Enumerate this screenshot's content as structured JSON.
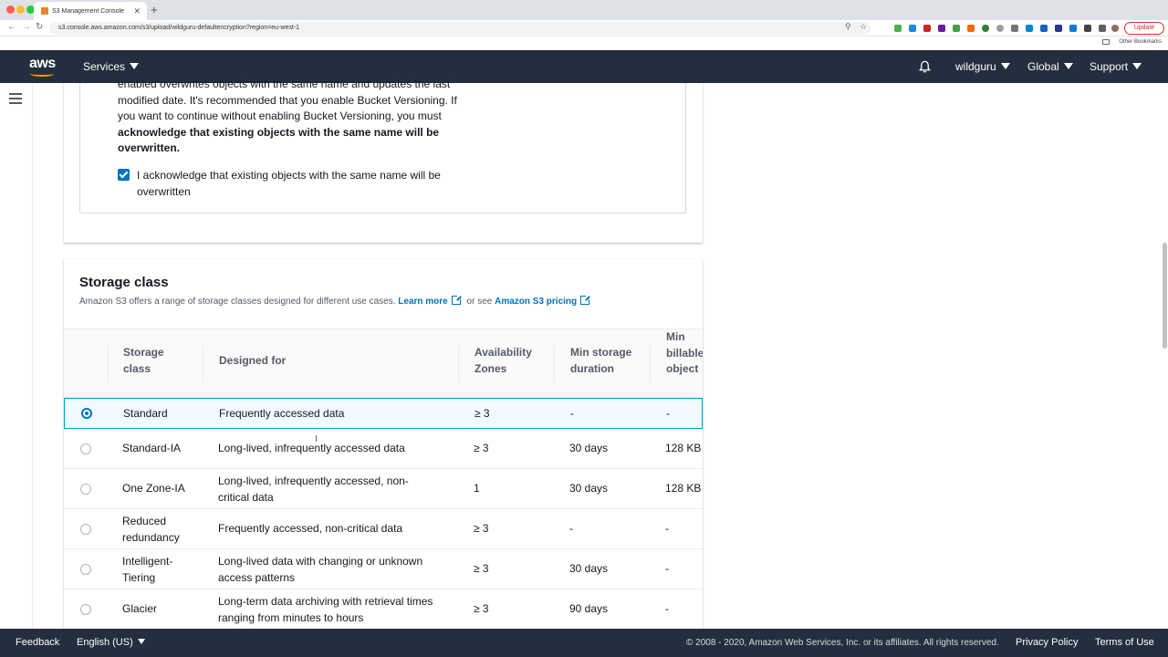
{
  "browser": {
    "tab_title": "S3 Management Console",
    "url": "s3.console.aws.amazon.com/s3/upload/wildguru-defaultencryption?region=eu-west-1",
    "update_label": "Update",
    "other_bookmarks": "Other Bookmarks"
  },
  "header": {
    "logo": "aws",
    "services_label": "Services",
    "account_label": "wildguru",
    "region_label": "Global",
    "support_label": "Support"
  },
  "versioning": {
    "warning_line1": "enabled overwrites objects with the same name and updates the last",
    "warning_line2": "modified date. It's recommended that you enable Bucket Versioning. If",
    "warning_line3": "you want to continue without enabling Bucket Versioning, you must",
    "warning_bold1": "acknowledge that existing objects with the same name will be",
    "warning_bold2": "overwritten.",
    "acknowledge_label": "I acknowledge that existing objects with the same name will be overwritten"
  },
  "storage_class": {
    "title": "Storage class",
    "description": "Amazon S3 offers a range of storage classes designed for different use cases.",
    "learn_more": "Learn more",
    "or_see": "or see",
    "pricing_link": "Amazon S3 pricing",
    "columns": {
      "storage_class": "Storage class",
      "designed_for": "Designed for",
      "availability_zones": "Availability Zones",
      "min_storage_duration": "Min storage duration",
      "min_billable": "Min billable object"
    },
    "rows": [
      {
        "name": "Standard",
        "designed_for": "Frequently accessed data",
        "az": "≥ 3",
        "min_duration": "-",
        "min_billable": "-"
      },
      {
        "name": "Standard-IA",
        "designed_for": "Long-lived, infrequently accessed data",
        "az": "≥ 3",
        "min_duration": "30 days",
        "min_billable": "128 KB"
      },
      {
        "name": "One Zone-IA",
        "designed_for": "Long-lived, infrequently accessed, non-critical data",
        "az": "1",
        "min_duration": "30 days",
        "min_billable": "128 KB"
      },
      {
        "name": "Reduced redundancy",
        "designed_for": "Frequently accessed, non-critical data",
        "az": "≥ 3",
        "min_duration": "-",
        "min_billable": "-"
      },
      {
        "name": "Intelligent-Tiering",
        "designed_for": "Long-lived data with changing or unknown access patterns",
        "az": "≥ 3",
        "min_duration": "30 days",
        "min_billable": "-"
      },
      {
        "name": "Glacier",
        "designed_for": "Long-term data archiving with retrieval times ranging from minutes to hours",
        "az": "≥ 3",
        "min_duration": "90 days",
        "min_billable": "-"
      }
    ]
  },
  "footer": {
    "feedback": "Feedback",
    "language": "English (US)",
    "copyright": "© 2008 - 2020, Amazon Web Services, Inc. or its affiliates. All rights reserved.",
    "privacy": "Privacy Policy",
    "terms": "Terms of Use"
  },
  "colors": {
    "nav_bg": "#232f3e",
    "link": "#0073bb",
    "selected_row_border": "#00a1c9"
  }
}
